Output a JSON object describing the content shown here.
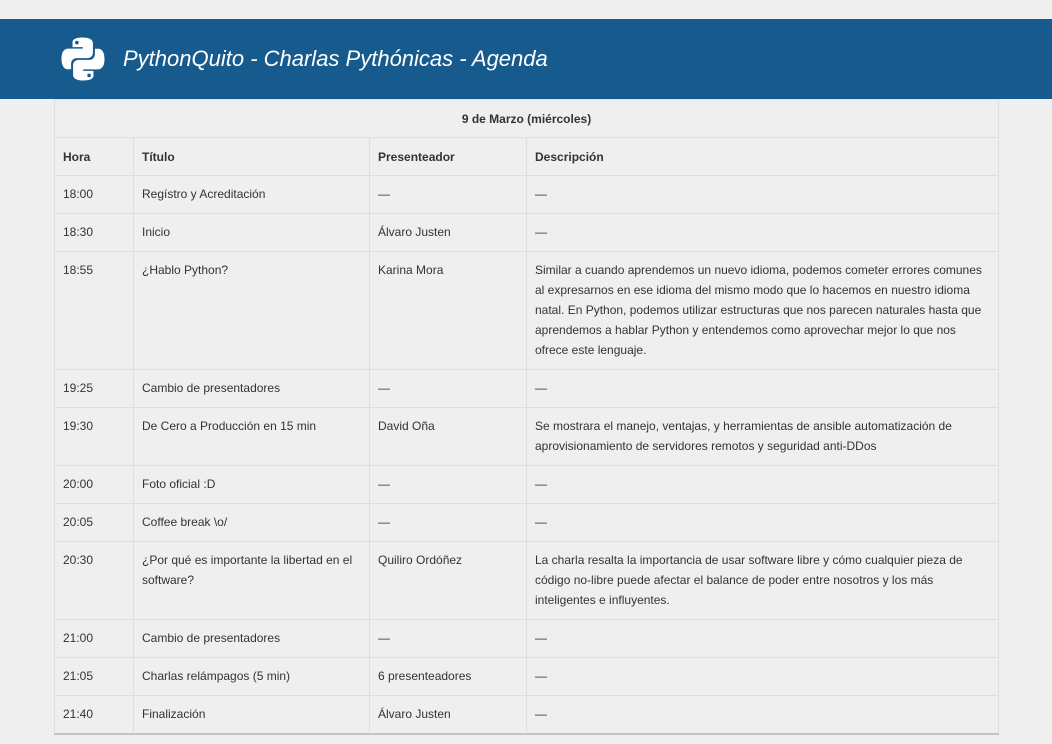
{
  "header": {
    "title": "PythonQuito - Charlas Pythónicas - Agenda",
    "logo": "python-logo",
    "colors": {
      "bar": "#175a8e",
      "logo_fill": "#ffffff"
    }
  },
  "agenda": {
    "day": "9 de Marzo (miércoles)",
    "columns": [
      "Hora",
      "Título",
      "Presenteador",
      "Descripción"
    ],
    "rows": [
      {
        "hora": "18:00",
        "titulo": "Regístro y Acreditación",
        "presentador": "—",
        "descripcion": "—"
      },
      {
        "hora": "18:30",
        "titulo": "Inicio",
        "presentador": "Álvaro Justen",
        "descripcion": "—"
      },
      {
        "hora": "18:55",
        "titulo": "¿Hablo Python?",
        "presentador": "Karina Mora",
        "descripcion": "Similar a cuando aprendemos un nuevo idioma, podemos cometer errores comunes al expresarnos en ese idioma del mismo modo que lo hacemos en nuestro idioma natal. En Python, podemos utilizar estructuras que nos parecen naturales hasta que aprendemos a hablar Python y entendemos como aprovechar mejor lo que nos ofrece este lenguaje."
      },
      {
        "hora": "19:25",
        "titulo": "Cambio de presentadores",
        "presentador": "—",
        "descripcion": "—"
      },
      {
        "hora": "19:30",
        "titulo": "De Cero a Producción en 15 min",
        "presentador": "David Oña",
        "descripcion": "Se mostrara el manejo, ventajas, y herramientas de ansible automatización de aprovisionamiento de servidores remotos y seguridad anti-DDos"
      },
      {
        "hora": "20:00",
        "titulo": "Foto oficial :D",
        "presentador": "—",
        "descripcion": "—"
      },
      {
        "hora": "20:05",
        "titulo": "Coffee break \\o/",
        "presentador": "—",
        "descripcion": "—"
      },
      {
        "hora": "20:30",
        "titulo": "¿Por qué es importante la libertad en el software?",
        "presentador": "Quiliro Ordóñez",
        "descripcion": "La charla resalta la importancia de usar software libre y cómo cualquier pieza de código no-libre puede afectar el balance de poder entre nosotros y los más inteligentes e influyentes."
      },
      {
        "hora": "21:00",
        "titulo": "Cambio de presentadores",
        "presentador": "—",
        "descripcion": "—"
      },
      {
        "hora": "21:05",
        "titulo": "Charlas relámpagos (5 min)",
        "presentador": "6 presenteadores",
        "descripcion": "—"
      },
      {
        "hora": "21:40",
        "titulo": "Finalización",
        "presentador": "Álvaro Justen",
        "descripcion": "—"
      }
    ]
  }
}
